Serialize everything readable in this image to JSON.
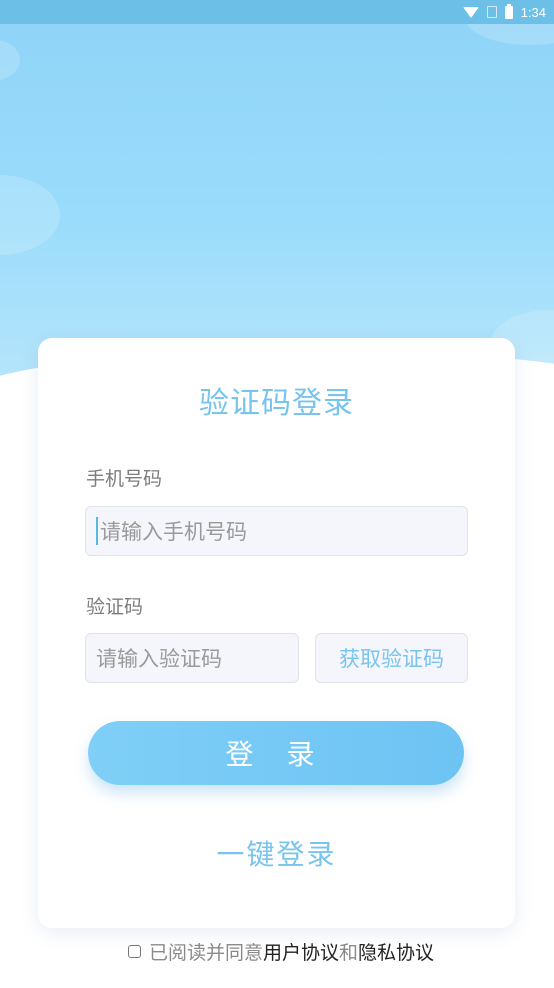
{
  "status_bar": {
    "time": "1:34",
    "icons": [
      "wifi-icon",
      "no-sim-icon",
      "battery-charging-icon"
    ]
  },
  "login": {
    "title": "验证码登录",
    "phone_label": "手机号码",
    "phone_placeholder": "请输入手机号码",
    "code_label": "验证码",
    "code_placeholder": "请输入验证码",
    "get_code_label": "获取验证码",
    "login_button": "登 录",
    "one_key_login": "一键登录"
  },
  "agreement": {
    "prefix": "已阅读并同意",
    "user_agreement": "用户协议",
    "and": "和",
    "privacy_policy": "隐私协议",
    "checked": false
  },
  "colors": {
    "accent": "#78c4ec",
    "button": "#6dc3f3",
    "hero": "#9adcfb"
  }
}
